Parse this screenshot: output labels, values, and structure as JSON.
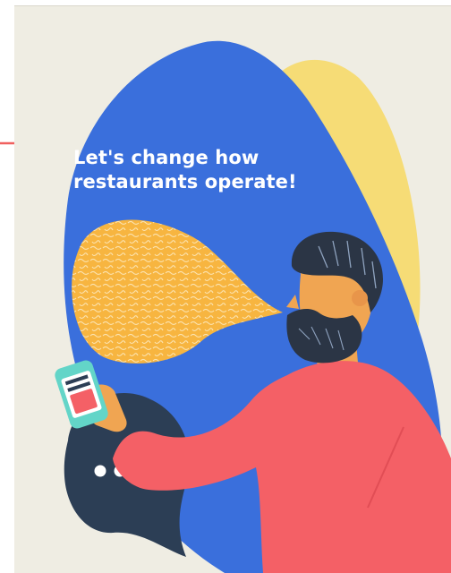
{
  "hero": {
    "headline_line1": "Let's change how",
    "headline_line2": "restaurants operate!"
  },
  "colors": {
    "background": "#efede3",
    "blue_blob": "#3a6fdc",
    "yellow_blob": "#f6dc76",
    "orange_bubble": "#f7b540",
    "dark_bubble": "#2c3e55",
    "sweater": "#f46066",
    "skin": "#f0a552",
    "hair": "#2b3545",
    "connector": "#f0605e",
    "phone_case": "#63d5c8"
  },
  "icons": {
    "connector": "timeline-node-icon",
    "phone": "smartphone-icon",
    "typing": "typing-ellipsis-icon"
  }
}
